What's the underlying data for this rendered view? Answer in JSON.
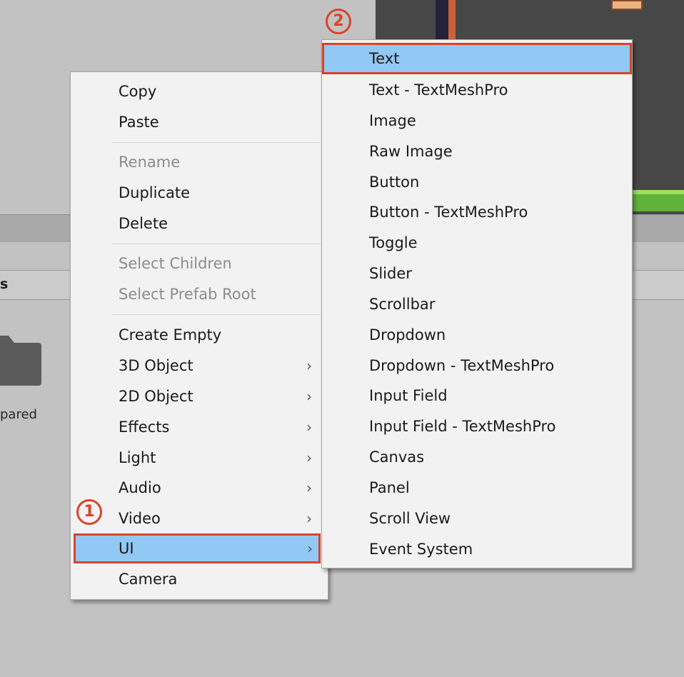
{
  "background": {
    "panel_label": "s",
    "folder_label": "pared"
  },
  "context_menu": {
    "items": [
      {
        "label": "Copy",
        "enabled": true
      },
      {
        "label": "Paste",
        "enabled": true
      },
      {
        "label": "Rename",
        "enabled": false
      },
      {
        "label": "Duplicate",
        "enabled": true
      },
      {
        "label": "Delete",
        "enabled": true
      },
      {
        "label": "Select Children",
        "enabled": false
      },
      {
        "label": "Select Prefab Root",
        "enabled": false
      },
      {
        "label": "Create Empty",
        "enabled": true
      },
      {
        "label": "3D Object",
        "enabled": true,
        "submenu": true
      },
      {
        "label": "2D Object",
        "enabled": true,
        "submenu": true
      },
      {
        "label": "Effects",
        "enabled": true,
        "submenu": true
      },
      {
        "label": "Light",
        "enabled": true,
        "submenu": true
      },
      {
        "label": "Audio",
        "enabled": true,
        "submenu": true
      },
      {
        "label": "Video",
        "enabled": true,
        "submenu": true
      },
      {
        "label": "UI",
        "enabled": true,
        "submenu": true,
        "highlighted": true
      },
      {
        "label": "Camera",
        "enabled": true
      }
    ],
    "submenu_arrow": "›"
  },
  "ui_submenu": {
    "items": [
      {
        "label": "Text",
        "highlighted": true
      },
      {
        "label": "Text - TextMeshPro"
      },
      {
        "label": "Image"
      },
      {
        "label": "Raw Image"
      },
      {
        "label": "Button"
      },
      {
        "label": "Button - TextMeshPro"
      },
      {
        "label": "Toggle"
      },
      {
        "label": "Slider"
      },
      {
        "label": "Scrollbar"
      },
      {
        "label": "Dropdown"
      },
      {
        "label": "Dropdown - TextMeshPro"
      },
      {
        "label": "Input Field"
      },
      {
        "label": "Input Field - TextMeshPro"
      },
      {
        "label": "Canvas"
      },
      {
        "label": "Panel"
      },
      {
        "label": "Scroll View"
      },
      {
        "label": "Event System"
      }
    ]
  },
  "annotations": {
    "step1": "1",
    "step2": "2",
    "color": "#d9442a"
  },
  "colors": {
    "highlight": "#92c8f4",
    "menu_bg": "#f2f2f2",
    "disabled_text": "#8c8c8c"
  }
}
